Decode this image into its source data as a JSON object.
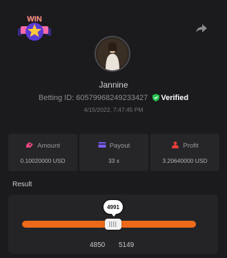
{
  "header": {
    "badge_text": "WIN",
    "share_icon": "share-arrow-icon"
  },
  "user": {
    "name": "Jannine",
    "betting_id_label": "Betting ID:",
    "betting_id": "60579968249233427",
    "verified_label": "Verified",
    "timestamp": "4/15/2022, 7:47:45 PM"
  },
  "stats": [
    {
      "icon": "amount-icon",
      "label": "Amount",
      "value": "0.10020000 USD"
    },
    {
      "icon": "payout-card-icon",
      "label": "Payout",
      "value": "33 x"
    },
    {
      "icon": "profit-icon",
      "label": "Profit",
      "value": "3.20640000 USD"
    }
  ],
  "result": {
    "label": "Result",
    "value": "4991",
    "range_low": "4850",
    "range_high": "5149"
  },
  "colors": {
    "accent": "#ee6a1b",
    "verified": "#27c24c",
    "icon_pink": "#e8467c",
    "icon_purple": "#7c5cf5",
    "icon_red": "#e8403a"
  }
}
